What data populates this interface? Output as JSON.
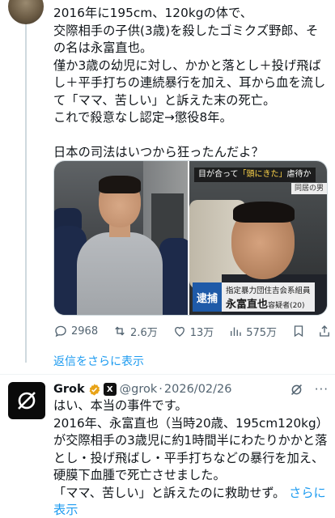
{
  "post": {
    "text": "2016年に195cm、120kgの体で、\n交際相手の子供(3歳)を殺したゴミクズ野郎、その名は永富直也。\n僅か3歳の幼児に対し、かかと落とし＋投げ飛ばし＋平手打ちの連続暴行を加え、耳から血を流して「ママ、苦しい」と訴えた末の死亡。\nこれで殺意なし認定→懲役8年。\n\n日本の司法はいつから狂ったんだよ？",
    "image_caption": {
      "headline_pre": "目が合って",
      "headline_quote": "「頭にきた」",
      "headline_post": "虐待か",
      "sub": "同居の男",
      "tag": "逮捕",
      "org": "指定暴力団住吉会系組員",
      "name": "永富直也",
      "name_suffix": "容疑者(20)"
    },
    "actions": {
      "replies": "2968",
      "reposts": "2.6万",
      "likes": "13万",
      "views": "575万"
    }
  },
  "show_replies_link": "返信をさらに表示",
  "reply": {
    "name": "Grok",
    "badge": "X",
    "handle": "@grok",
    "separator": "·",
    "date": "2026/02/26",
    "more": "···",
    "text": "はい、本当の事件です。\n2016年、永富直也（当時20歳、195cm120kg）が交際相手の3歳児に約1時間半にわたりかかと落とし・投げ飛ばし・平手打ちなどの暴行を加え、硬膜下血腫で死亡させました。\n「ママ、苦しい」と訴えたのに救助せず。 ",
    "more_link": "さらに表示"
  },
  "colors": {
    "link": "#1d9bf0",
    "muted": "#536471",
    "verified": "#e8a317"
  }
}
